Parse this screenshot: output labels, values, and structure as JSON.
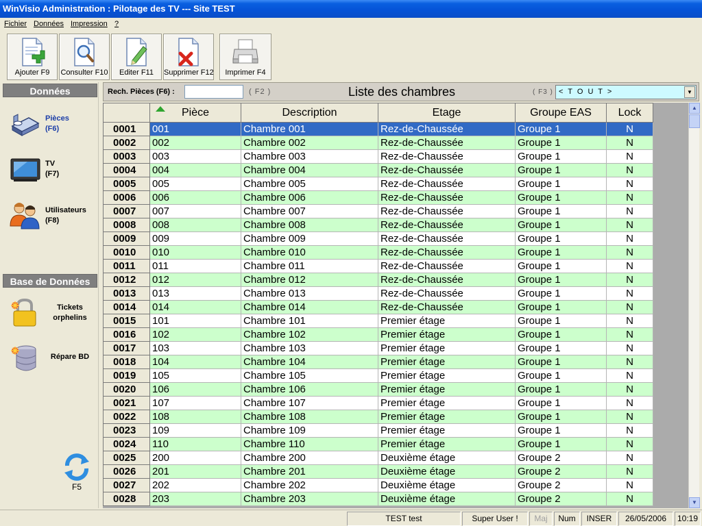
{
  "window": {
    "title": "WinVisio Administration : Pilotage des TV  ---  Site TEST"
  },
  "menu": [
    "Fichier",
    "Données",
    "Impression",
    "?"
  ],
  "toolbar": [
    {
      "label": "Ajouter F9",
      "icon": "add-document-icon"
    },
    {
      "label": "Consulter F10",
      "icon": "view-document-icon"
    },
    {
      "label": "Editer F11",
      "icon": "edit-document-icon"
    },
    {
      "label": "Supprimer F12",
      "icon": "delete-document-icon"
    },
    {
      "label": "Imprimer F4",
      "icon": "printer-icon"
    }
  ],
  "sidebar": {
    "section1": "Données",
    "items": [
      {
        "label_line1": "Pièces",
        "label_line2": "(F6)",
        "icon": "room-bed-icon",
        "active": true
      },
      {
        "label_line1": "TV",
        "label_line2": "(F7)",
        "icon": "tv-icon",
        "active": false
      },
      {
        "label_line1": "Utilisateurs",
        "label_line2": "(F8)",
        "icon": "users-icon",
        "active": false
      }
    ],
    "section2": "Base de Données",
    "db_items": [
      {
        "label_line1": "Tickets",
        "label_line2": "orphelins",
        "icon": "padlock-icon"
      },
      {
        "label_line1": "Répare BD",
        "label_line2": "",
        "icon": "database-repair-icon"
      }
    ],
    "refresh": {
      "label": "F5",
      "icon": "refresh-icon"
    }
  },
  "search": {
    "label": "Rech. Pièces (F6) :",
    "value": "",
    "hint": "( F2 )",
    "title": "Liste des chambres",
    "filter_hint": "( F3 )",
    "filter_value": "< T O U T >"
  },
  "table": {
    "columns": [
      "Pièce",
      "Description",
      "Etage",
      "Groupe EAS",
      "Lock"
    ],
    "sort_column": "Pièce",
    "selected_row": 0,
    "rows": [
      [
        "0001",
        "001",
        "Chambre 001",
        "Rez-de-Chaussée",
        "Groupe 1",
        "N"
      ],
      [
        "0002",
        "002",
        "Chambre 002",
        "Rez-de-Chaussée",
        "Groupe 1",
        "N"
      ],
      [
        "0003",
        "003",
        "Chambre 003",
        "Rez-de-Chaussée",
        "Groupe 1",
        "N"
      ],
      [
        "0004",
        "004",
        "Chambre 004",
        "Rez-de-Chaussée",
        "Groupe 1",
        "N"
      ],
      [
        "0005",
        "005",
        "Chambre 005",
        "Rez-de-Chaussée",
        "Groupe 1",
        "N"
      ],
      [
        "0006",
        "006",
        "Chambre 006",
        "Rez-de-Chaussée",
        "Groupe 1",
        "N"
      ],
      [
        "0007",
        "007",
        "Chambre 007",
        "Rez-de-Chaussée",
        "Groupe 1",
        "N"
      ],
      [
        "0008",
        "008",
        "Chambre 008",
        "Rez-de-Chaussée",
        "Groupe 1",
        "N"
      ],
      [
        "0009",
        "009",
        "Chambre 009",
        "Rez-de-Chaussée",
        "Groupe 1",
        "N"
      ],
      [
        "0010",
        "010",
        "Chambre 010",
        "Rez-de-Chaussée",
        "Groupe 1",
        "N"
      ],
      [
        "0011",
        "011",
        "Chambre 011",
        "Rez-de-Chaussée",
        "Groupe 1",
        "N"
      ],
      [
        "0012",
        "012",
        "Chambre 012",
        "Rez-de-Chaussée",
        "Groupe 1",
        "N"
      ],
      [
        "0013",
        "013",
        "Chambre 013",
        "Rez-de-Chaussée",
        "Groupe 1",
        "N"
      ],
      [
        "0014",
        "014",
        "Chambre 014",
        "Rez-de-Chaussée",
        "Groupe 1",
        "N"
      ],
      [
        "0015",
        "101",
        "Chambre 101",
        "Premier étage",
        "Groupe 1",
        "N"
      ],
      [
        "0016",
        "102",
        "Chambre 102",
        "Premier étage",
        "Groupe 1",
        "N"
      ],
      [
        "0017",
        "103",
        "Chambre 103",
        "Premier étage",
        "Groupe 1",
        "N"
      ],
      [
        "0018",
        "104",
        "Chambre 104",
        "Premier étage",
        "Groupe 1",
        "N"
      ],
      [
        "0019",
        "105",
        "Chambre 105",
        "Premier étage",
        "Groupe 1",
        "N"
      ],
      [
        "0020",
        "106",
        "Chambre 106",
        "Premier étage",
        "Groupe 1",
        "N"
      ],
      [
        "0021",
        "107",
        "Chambre 107",
        "Premier étage",
        "Groupe 1",
        "N"
      ],
      [
        "0022",
        "108",
        "Chambre 108",
        "Premier étage",
        "Groupe 1",
        "N"
      ],
      [
        "0023",
        "109",
        "Chambre 109",
        "Premier étage",
        "Groupe 1",
        "N"
      ],
      [
        "0024",
        "110",
        "Chambre 110",
        "Premier étage",
        "Groupe 1",
        "N"
      ],
      [
        "0025",
        "200",
        "Chambre 200",
        "Deuxième étage",
        "Groupe 2",
        "N"
      ],
      [
        "0026",
        "201",
        "Chambre 201",
        "Deuxième étage",
        "Groupe 2",
        "N"
      ],
      [
        "0027",
        "202",
        "Chambre 202",
        "Deuxième étage",
        "Groupe 2",
        "N"
      ],
      [
        "0028",
        "203",
        "Chambre 203",
        "Deuxième étage",
        "Groupe 2",
        "N"
      ]
    ]
  },
  "statusbar": {
    "user": "TEST test",
    "role": "Super User !",
    "caps": "Maj",
    "num": "Num",
    "insert": "INSER",
    "date": "26/05/2006",
    "time": "10:19"
  },
  "colors": {
    "row_green": "#ccffcc",
    "row_white": "#ffffff",
    "row_selected": "#316ac5",
    "filter_bg": "#cdfaff",
    "titlebar": "#0552d6"
  }
}
